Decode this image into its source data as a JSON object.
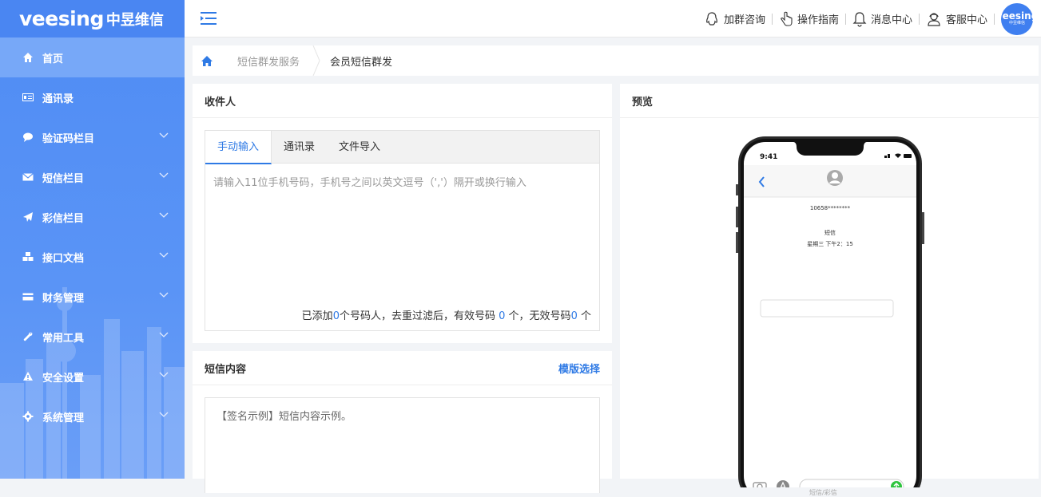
{
  "brand": {
    "logo_word": "veesing",
    "logo_cn": "中昱维信"
  },
  "sidebar": {
    "items": [
      {
        "label": "首页",
        "icon": "home-icon",
        "active": true,
        "expandable": false
      },
      {
        "label": "通讯录",
        "icon": "address-card-icon",
        "active": false,
        "expandable": false
      },
      {
        "label": "验证码栏目",
        "icon": "chat-bubble-icon",
        "active": false,
        "expandable": true
      },
      {
        "label": "短信栏目",
        "icon": "envelope-icon",
        "active": false,
        "expandable": true
      },
      {
        "label": "彩信栏目",
        "icon": "paper-plane-icon",
        "active": false,
        "expandable": true
      },
      {
        "label": "接口文档",
        "icon": "cubes-icon",
        "active": false,
        "expandable": true
      },
      {
        "label": "财务管理",
        "icon": "credit-card-icon",
        "active": false,
        "expandable": true
      },
      {
        "label": "常用工具",
        "icon": "wrench-icon",
        "active": false,
        "expandable": true
      },
      {
        "label": "安全设置",
        "icon": "warning-icon",
        "active": false,
        "expandable": true
      },
      {
        "label": "系统管理",
        "icon": "gear-icon",
        "active": false,
        "expandable": true
      }
    ]
  },
  "topbar": {
    "links": [
      {
        "label": "加群咨询",
        "icon": "qq-icon"
      },
      {
        "label": "操作指南",
        "icon": "pointer-hand-icon"
      },
      {
        "label": "消息中心",
        "icon": "bell-icon"
      },
      {
        "label": "客服中心",
        "icon": "support-agent-icon"
      }
    ],
    "avatar_word": "veesing",
    "avatar_cn": "中昱维信"
  },
  "breadcrumb": {
    "items": [
      "短信群发服务",
      "会员短信群发"
    ]
  },
  "recipients": {
    "title": "收件人",
    "tabs": [
      "手动输入",
      "通讯录",
      "文件导入"
    ],
    "active_tab": 0,
    "placeholder": "请输入11位手机号码，手机号之间以英文逗号（','）隔开或换行输入",
    "count_prefix": "已添加",
    "count_added": "0",
    "count_mid": "个号码人，去重过滤后，有效号码",
    "count_valid": "0",
    "count_mid2": "个，无效号码",
    "count_invalid": "0",
    "count_suffix": "个"
  },
  "sms_content": {
    "title": "短信内容",
    "template_link": "模版选择",
    "text": "【签名示例】短信内容示例。"
  },
  "preview": {
    "title": "预览",
    "time": "9:41",
    "number": "10658********",
    "label": "短信",
    "date": "星期三 下午2：15",
    "input_placeholder": "短信/彩信"
  },
  "colors": {
    "sidebar": "#4f8cf4",
    "accent": "#2f7ae5",
    "send": "#2ec43d"
  }
}
